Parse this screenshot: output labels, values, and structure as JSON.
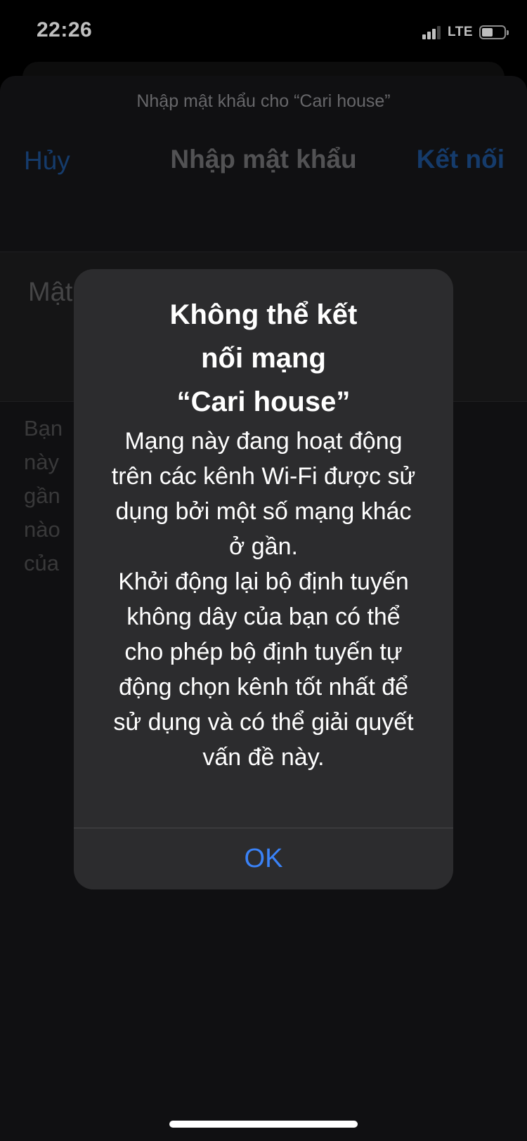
{
  "status_bar": {
    "time": "22:26",
    "network": "LTE",
    "signal_bars_active": 3,
    "signal_bars_total": 4,
    "battery_level": 0.5
  },
  "sheet": {
    "subtitle": "Nhập mật khẩu cho “Cari house”",
    "cancel_label": "Hủy",
    "title": "Nhập mật khẩu",
    "connect_label": "Kết nối",
    "password_label": "Mật",
    "footnote_lines": [
      "Bạn",
      "này",
      "gần",
      "nào",
      "của"
    ]
  },
  "alert": {
    "title_lines": [
      "Không thể kết",
      "nối mạng",
      "“Cari house”"
    ],
    "message_lines": [
      "Mạng này đang hoạt động",
      "trên các kênh Wi-Fi được sử",
      "dụng bởi một số mạng khác",
      "ở gần.",
      "Khởi động lại bộ định tuyến",
      "không dây của bạn có thể",
      "cho phép bộ định tuyến tự",
      "động chọn kênh tốt nhất để",
      "sử dụng và có thể giải quyết",
      "vấn đề này."
    ],
    "ok_label": "OK"
  },
  "colors": {
    "accent_blue": "#3a82f7",
    "dimmed_blue": "#1d4f8f",
    "alert_bg": "#2c2c2e"
  }
}
